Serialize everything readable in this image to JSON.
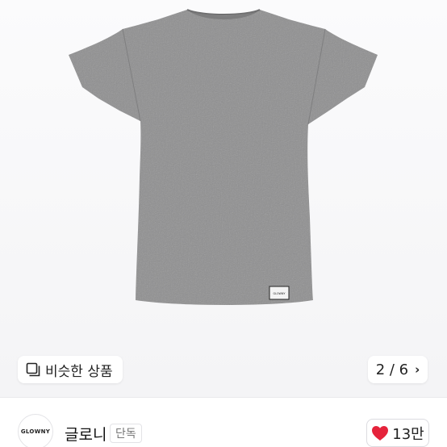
{
  "product_image": {
    "shirt_color": "#8f8f90",
    "label_text": "GLOWNY"
  },
  "similar_button": {
    "label": "비슷한 상품",
    "icon": "similar-items-icon"
  },
  "gallery": {
    "counter": "2 / 6",
    "next_icon": "chevron-right-icon"
  },
  "brand": {
    "logo_text": "GLOWNY",
    "name": "글로니",
    "tag": "단독"
  },
  "like": {
    "count": "13만",
    "icon": "heart-icon",
    "heart_color": "#e5233b"
  }
}
